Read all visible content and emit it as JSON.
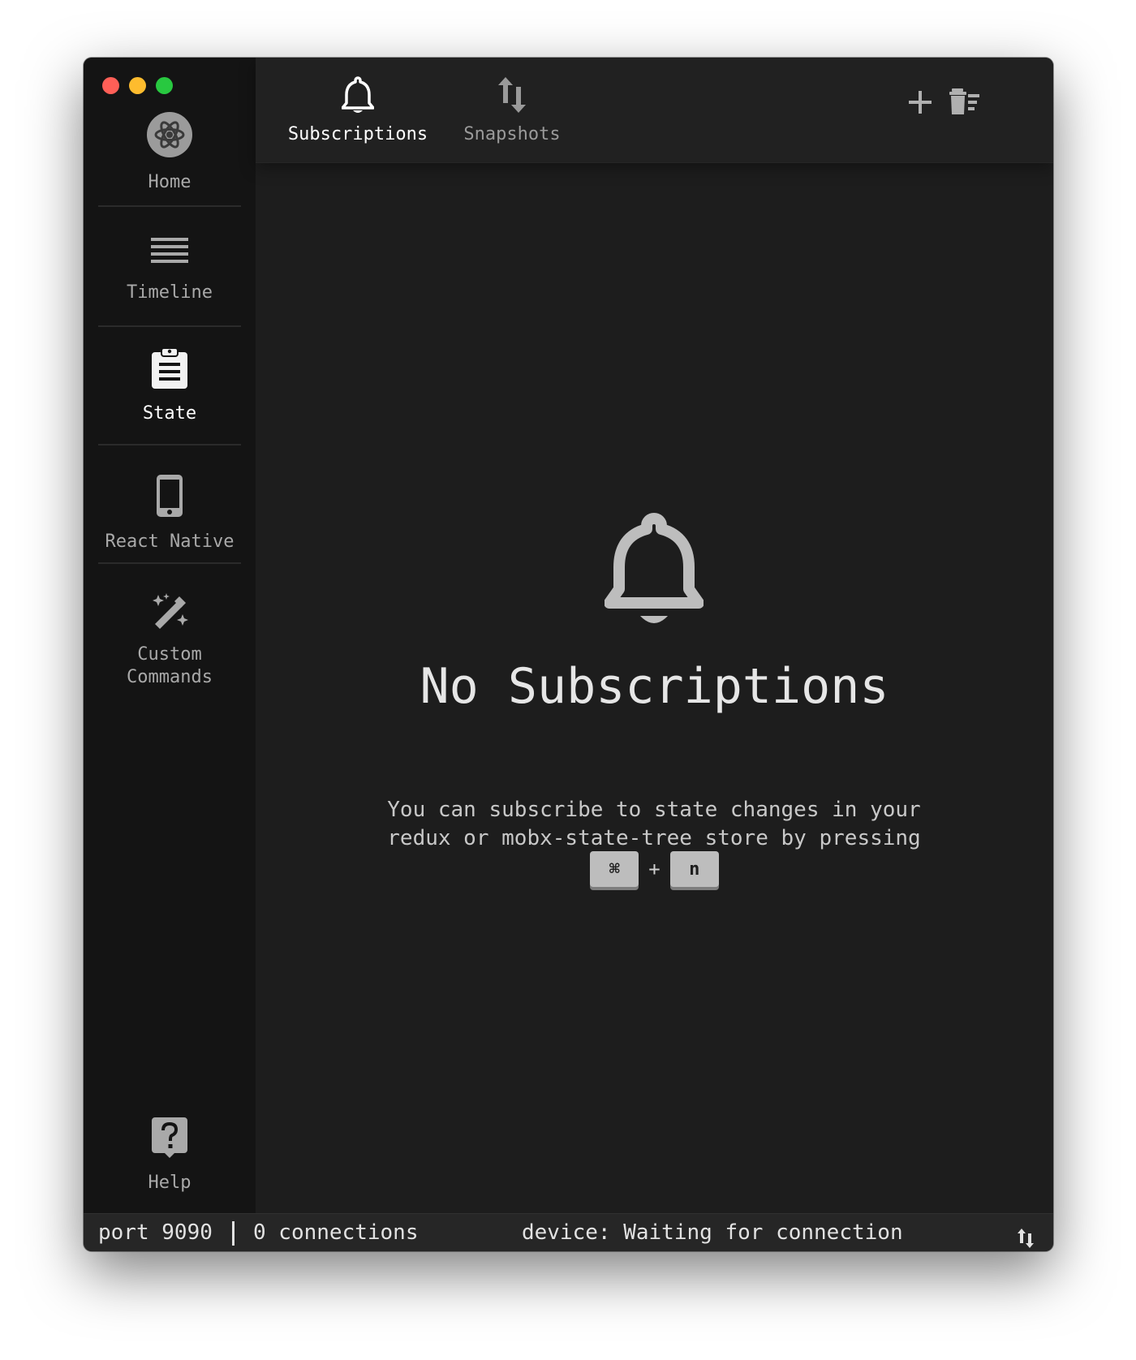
{
  "window": {
    "traffic_lights": [
      "close",
      "minimize",
      "maximize"
    ]
  },
  "sidebar": {
    "items": [
      {
        "label": "Home",
        "icon": "reactotron-logo-icon",
        "active": false
      },
      {
        "label": "Timeline",
        "icon": "list-lines-icon",
        "active": false
      },
      {
        "label": "State",
        "icon": "clipboard-icon",
        "active": true
      },
      {
        "label": "React Native",
        "icon": "phone-icon",
        "active": false
      },
      {
        "label": "Custom",
        "label2": "Commands",
        "icon": "magic-wand-icon",
        "active": false
      }
    ],
    "help": {
      "label": "Help",
      "icon": "help-bubble-icon"
    }
  },
  "toolbar": {
    "tabs": [
      {
        "label": "Subscriptions",
        "icon": "bell-icon",
        "active": true
      },
      {
        "label": "Snapshots",
        "icon": "swap-arrows-icon",
        "active": false
      }
    ],
    "actions": [
      {
        "name": "add",
        "icon": "plus-icon"
      },
      {
        "name": "clear",
        "icon": "trash-list-icon"
      }
    ]
  },
  "empty_state": {
    "icon": "bell-icon",
    "title": "No Subscriptions",
    "message": "You can subscribe to state changes in your redux or mobx-state-tree store by pressing",
    "shortcut": {
      "key1": "⌘",
      "plus": "+",
      "key2": "n"
    }
  },
  "statusbar": {
    "port": "port 9090",
    "connections": "0 connections",
    "device": "device: Waiting for connection",
    "icon": "swap-arrows-icon"
  },
  "colors": {
    "sidebar_bg": "#141414",
    "main_bg": "#1d1d1d",
    "toolbar_bg": "#212121",
    "statusbar_bg": "#262626",
    "active_text": "#ffffff",
    "inactive_text": "#a9a9a9"
  }
}
